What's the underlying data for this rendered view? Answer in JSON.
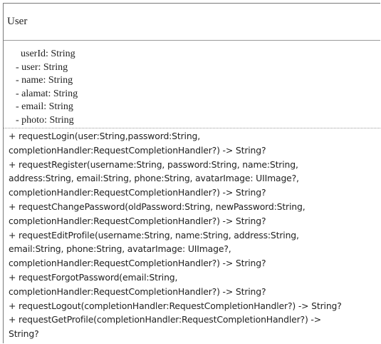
{
  "class_name": "User",
  "attributes": [
    "  userId: String",
    "- user: String",
    "- name: String",
    "- alamat: String",
    "- email: String",
    "- photo: String"
  ],
  "operation_lines": [
    "+ requestLogin(user:String,password:String,",
    "completionHandler:RequestCompletionHandler?) -> String?",
    "+ requestRegister(username:String, password:String, name:String,",
    "address:String, email:String, phone:String, avatarImage: UIImage?,",
    "completionHandler:RequestCompletionHandler?) -> String?",
    "+ requestChangePassword(oldPassword:String, newPassword:String,",
    "completionHandler:RequestCompletionHandler?) -> String?",
    "+ requestEditProfile(username:String, name:String, address:String,",
    "email:String, phone:String, avatarImage: UIImage?,",
    "completionHandler:RequestCompletionHandler?) -> String?",
    "+ requestForgotPassword(email:String,",
    "completionHandler:RequestCompletionHandler?) -> String?",
    "+ requestLogout(completionHandler:RequestCompletionHandler?) -> String?",
    "+ requestGetProfile(completionHandler:RequestCompletionHandler?) ->",
    "String?"
  ]
}
